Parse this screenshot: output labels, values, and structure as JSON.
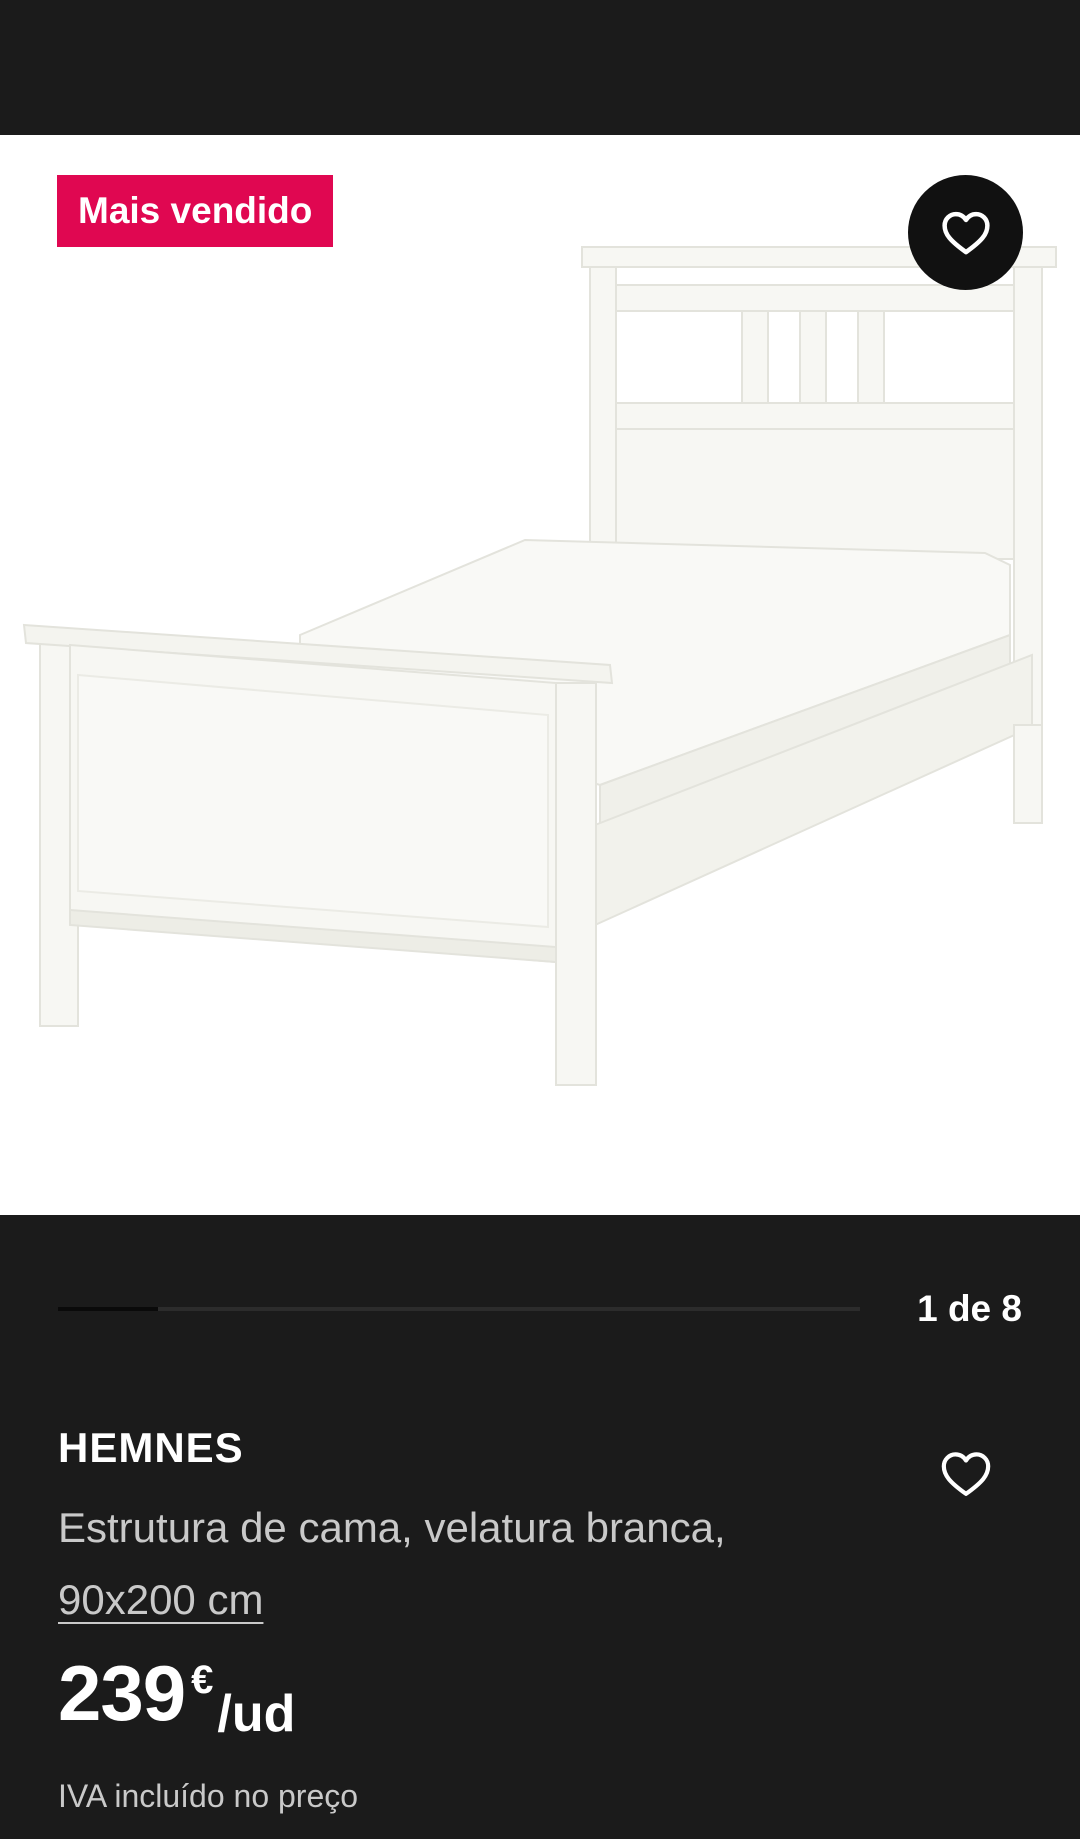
{
  "gallery": {
    "badge": "Mais vendido",
    "favorite_icon": "heart-icon",
    "image": "white-single-bed-frame",
    "progress_fraction": 0.125,
    "counter": "1 de 8"
  },
  "product": {
    "name": "HEMNES",
    "description": "Estrutura de cama, velatura branca,",
    "size": "90x200 cm",
    "favorite_icon": "heart-icon",
    "price": {
      "amount": "239",
      "currency": "€",
      "unit": "/ud"
    },
    "vat_note": "IVA incluído no preço"
  },
  "colors": {
    "background": "#1b1b1b",
    "badge": "#e00751",
    "text_primary": "#ffffff",
    "text_secondary": "#c9c9c9"
  }
}
